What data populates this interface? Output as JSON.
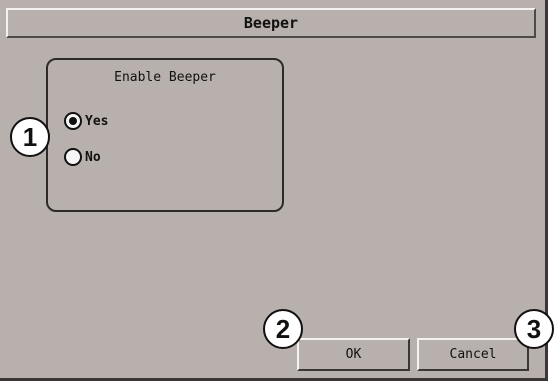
{
  "window": {
    "title": "Beeper"
  },
  "group": {
    "title": "Enable Beeper",
    "options": [
      {
        "label": "Yes",
        "checked": true
      },
      {
        "label": "No",
        "checked": false
      }
    ]
  },
  "buttons": {
    "ok_label": "OK",
    "cancel_label": "Cancel"
  },
  "callouts": [
    "1",
    "2",
    "3"
  ]
}
